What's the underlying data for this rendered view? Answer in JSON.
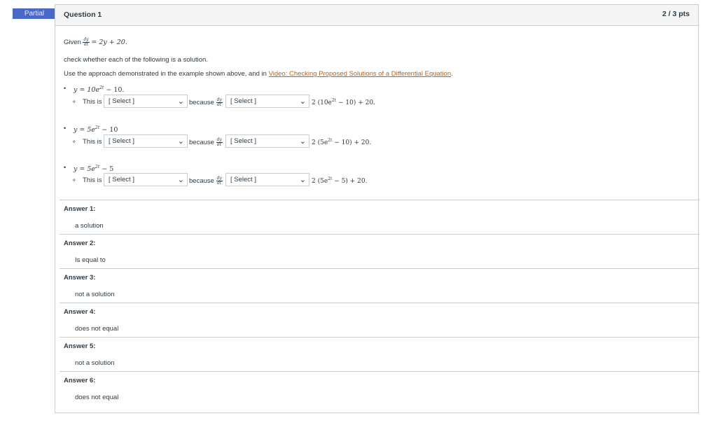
{
  "badge": {
    "label": "Partial"
  },
  "question": {
    "title": "Question 1",
    "points": "2 / 3 pts"
  },
  "intro": {
    "given_prefix": "Given",
    "given_rhs": "= 2y + 20.",
    "check_text": "check whether each of the following is a solution.",
    "approach_text": "Use the approach demonstrated in the example shown above, and in",
    "video_link": "Video: Checking Proposed Solutions of a Differential Equation",
    "approach_end": "."
  },
  "frac": {
    "num": "dy",
    "den": "dt"
  },
  "items": [
    {
      "expr": "y = 10e",
      "exp": "2t",
      "tail": " − 10.",
      "this_is": "This is",
      "select1": "[ Select ]",
      "because": "because",
      "select2": "[ Select ]",
      "rhs": "2 (10e",
      "rhs_exp": "2t",
      "rhs_tail": " − 10) + 20."
    },
    {
      "expr": "y = 5e",
      "exp": "2t",
      "tail": " − 10",
      "this_is": "This is",
      "select1": "[ Select ]",
      "because": "because",
      "select2": "[ Select ]",
      "rhs": "2 (5e",
      "rhs_exp": "2t",
      "rhs_tail": " − 10) + 20."
    },
    {
      "expr": "y = 5e",
      "exp": "2t",
      "tail": " − 5",
      "this_is": "This is",
      "select1": "[ Select ]",
      "because": "because",
      "select2": "[ Select ]",
      "rhs": "2 (5e",
      "rhs_exp": "2t",
      "rhs_tail": " − 5) + 20."
    }
  ],
  "answers": [
    {
      "label": "Answer 1:",
      "value": "a solution"
    },
    {
      "label": "Answer 2:",
      "value": "Is equal to"
    },
    {
      "label": "Answer 3:",
      "value": "not a solution"
    },
    {
      "label": "Answer 4:",
      "value": "does not equal"
    },
    {
      "label": "Answer 5:",
      "value": "not a solution"
    },
    {
      "label": "Answer 6:",
      "value": "does not equal"
    }
  ],
  "icons": {
    "chevron": "chevron-down-icon",
    "bullet": "disc-bullet-icon",
    "sub_bullet": "circle-bullet-icon"
  }
}
